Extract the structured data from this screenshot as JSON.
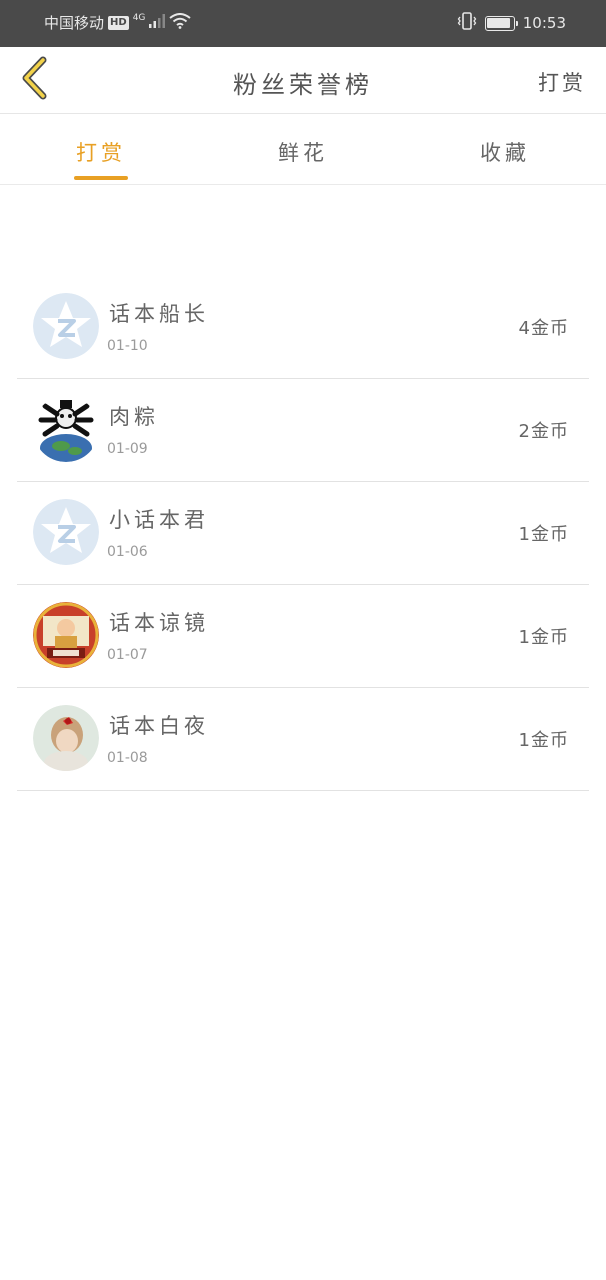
{
  "status_bar": {
    "carrier": "中国移动",
    "hd_badge": "HD",
    "network_badge": "4G",
    "time": "10:53",
    "icons": [
      "signal-icon",
      "wifi-icon",
      "vibrate-icon",
      "battery-icon"
    ]
  },
  "header": {
    "back_icon": "chevron-left-icon",
    "title": "粉丝荣誉榜",
    "action_label": "打赏"
  },
  "tabs": [
    {
      "label": "打赏",
      "active": true
    },
    {
      "label": "鲜花",
      "active": false
    },
    {
      "label": "收藏",
      "active": false
    }
  ],
  "accent_color": "#e8a024",
  "fans": [
    {
      "name": "话本船长",
      "date": "01-10",
      "amount": "4金币",
      "avatar": "default-star-avatar"
    },
    {
      "name": "肉粽",
      "date": "01-09",
      "amount": "2金币",
      "avatar": "panda-meme-avatar"
    },
    {
      "name": "小话本君",
      "date": "01-06",
      "amount": "1金币",
      "avatar": "default-star-avatar"
    },
    {
      "name": "话本谅镜",
      "date": "01-07",
      "amount": "1金币",
      "avatar": "cartoon-avatar"
    },
    {
      "name": "话本白夜",
      "date": "01-08",
      "amount": "1金币",
      "avatar": "girl-photo-avatar"
    }
  ]
}
